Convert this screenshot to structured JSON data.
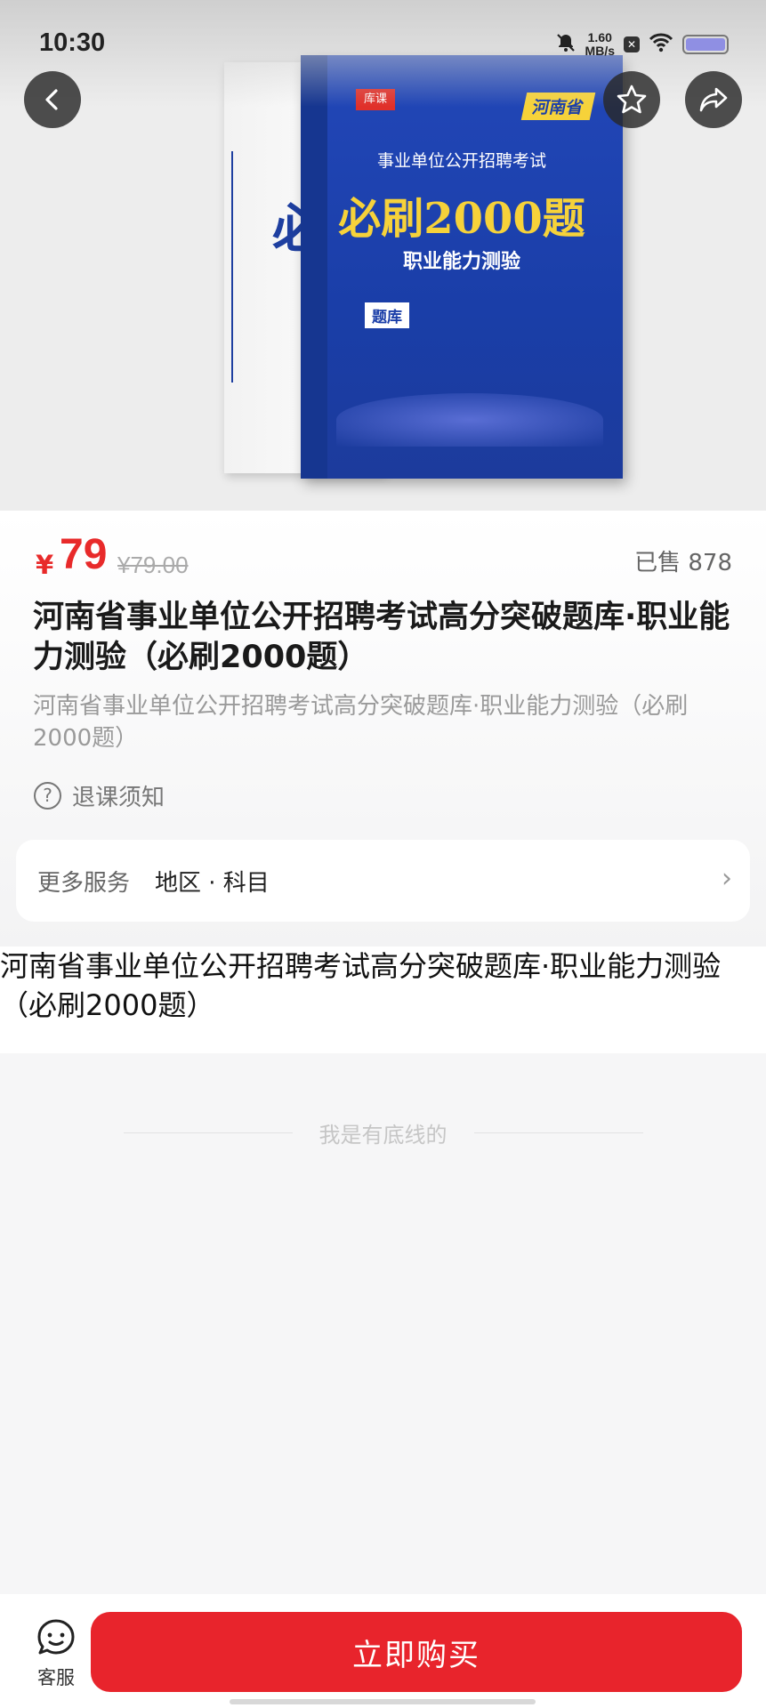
{
  "status_bar": {
    "time": "10:30",
    "speed_value": "1.60",
    "speed_unit": "MB/s",
    "icons": [
      "bell-muted-icon",
      "notification-x-icon",
      "wifi-icon",
      "battery-icon"
    ]
  },
  "hero": {
    "book": {
      "brand": "库课",
      "province": "河南省",
      "top_line": "事业单位公开招聘考试",
      "title": "必刷2000题",
      "subtitle": "职业能力测验",
      "tag": "题库",
      "back_char": "必"
    }
  },
  "product": {
    "currency": "¥",
    "price": "79",
    "original_price": "¥79.00",
    "sold": "已售 878",
    "title": "河南省事业单位公开招聘考试高分突破题库·职业能力测验（必刷2000题）",
    "subtitle": "河南省事业单位公开招聘考试高分突破题库·职业能力测验（必刷2000题）",
    "refund_notice": "退课须知"
  },
  "service": {
    "label": "更多服务",
    "value": "地区 · 科目"
  },
  "description": {
    "text": "河南省事业单位公开招聘考试高分突破题库·职业能力测验（必刷2000题）"
  },
  "footer_note": "我是有底线的",
  "bottom_bar": {
    "customer_service": "客服",
    "buy_now": "立即购买"
  },
  "colors": {
    "accent": "#e8242c",
    "book_blue": "#1a3ea8",
    "book_yellow": "#f6d23a"
  }
}
